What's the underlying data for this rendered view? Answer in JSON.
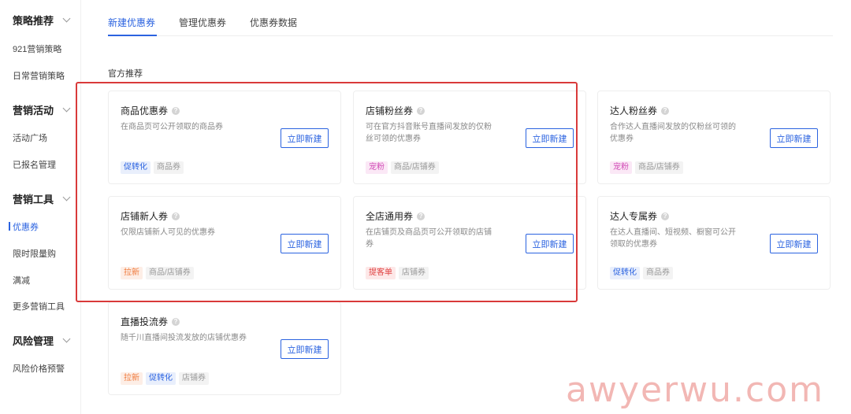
{
  "sidebar": {
    "groups": [
      {
        "label": "策略推荐",
        "items": [
          "921营销策略",
          "日常营销策略"
        ]
      },
      {
        "label": "营销活动",
        "items": [
          "活动广场",
          "已报名管理"
        ]
      },
      {
        "label": "营销工具",
        "items": [
          "优惠券",
          "限时限量购",
          "满减",
          "更多营销工具"
        ]
      },
      {
        "label": "风险管理",
        "items": [
          "风险价格预警"
        ]
      }
    ],
    "active_item": "优惠券"
  },
  "tabs": [
    "新建优惠券",
    "管理优惠券",
    "优惠券数据"
  ],
  "active_tab": "新建优惠券",
  "section_title": "官方推荐",
  "button_label": "立即新建",
  "cards": [
    {
      "title": "商品优惠券",
      "desc": "在商品页可公开领取的商品券",
      "tags": [
        {
          "text": "促转化",
          "color": "blue"
        },
        {
          "text": "商品券",
          "color": "gray"
        }
      ]
    },
    {
      "title": "店铺粉丝券",
      "desc": "可在官方抖音账号直播间发放的仅粉丝可领的优惠券",
      "tags": [
        {
          "text": "宠粉",
          "color": "pink"
        },
        {
          "text": "商品/店铺券",
          "color": "gray"
        }
      ]
    },
    {
      "title": "达人粉丝券",
      "desc": "合作达人直播间发放的仅粉丝可领的优惠券",
      "tags": [
        {
          "text": "宠粉",
          "color": "pink"
        },
        {
          "text": "商品/店铺券",
          "color": "gray"
        }
      ]
    },
    {
      "title": "店铺新人券",
      "desc": "仅限店铺新人可见的优惠券",
      "tags": [
        {
          "text": "拉新",
          "color": "orange"
        },
        {
          "text": "商品/店铺券",
          "color": "gray"
        }
      ]
    },
    {
      "title": "全店通用券",
      "desc": "在店铺页及商品页可公开领取的店铺券",
      "tags": [
        {
          "text": "提客单",
          "color": "red"
        },
        {
          "text": "店铺券",
          "color": "gray"
        }
      ]
    },
    {
      "title": "达人专属券",
      "desc": "在达人直播间、短视频、橱窗可公开领取的优惠券",
      "tags": [
        {
          "text": "促转化",
          "color": "blue"
        },
        {
          "text": "商品券",
          "color": "gray"
        }
      ]
    },
    {
      "title": "直播投流券",
      "desc": "随千川直播间投流发放的店铺优惠券",
      "tags": [
        {
          "text": "拉新",
          "color": "orange"
        },
        {
          "text": "促转化",
          "color": "blue"
        },
        {
          "text": "店铺券",
          "color": "gray"
        }
      ]
    }
  ],
  "watermark": "awyerwu.com",
  "colors": {
    "accent": "#2b63e0",
    "highlight_border": "#d93a3a"
  }
}
